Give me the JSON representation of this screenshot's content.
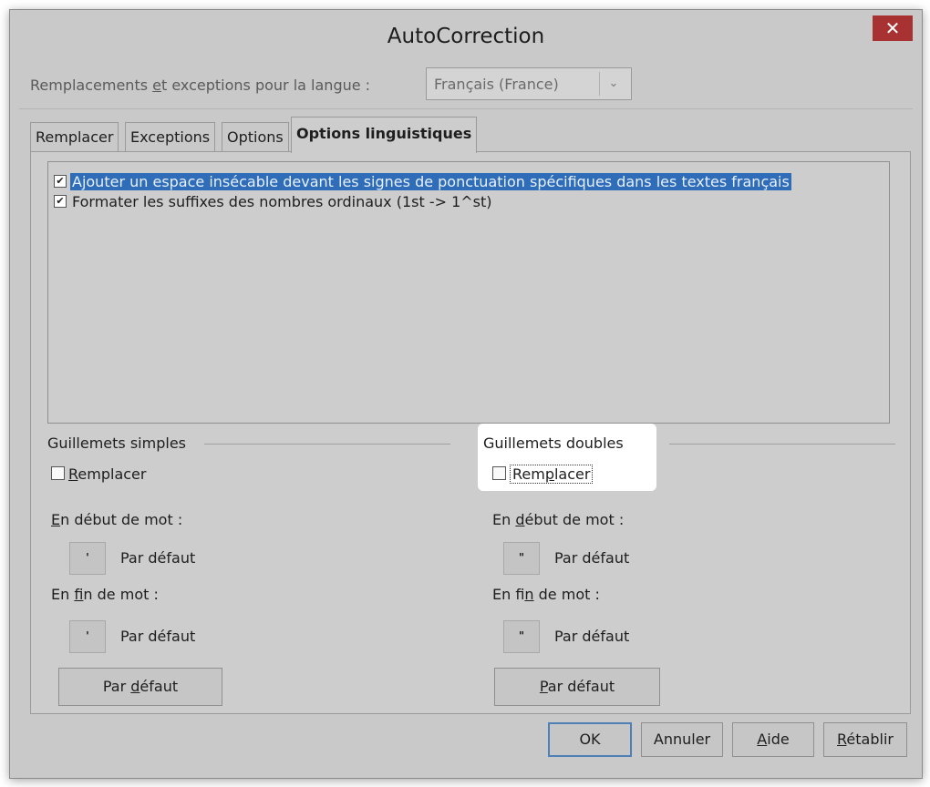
{
  "window": {
    "title": "AutoCorrection",
    "close_glyph": "✕"
  },
  "language": {
    "label_before": "Remplacements ",
    "label_accel": "e",
    "label_after": "t exceptions pour la langue :",
    "selected": "Français (France)",
    "arrow_icon": "chevron-down-icon"
  },
  "tabs": [
    {
      "label": "Remplacer",
      "active": false
    },
    {
      "label": "Exceptions",
      "active": false
    },
    {
      "label": "Options",
      "active": false
    },
    {
      "label": "Options linguistiques",
      "active": true
    }
  ],
  "options": [
    {
      "label": "Ajouter un espace insécable devant les signes de ponctuation spécifiques dans les textes français",
      "checked": true,
      "selected": true
    },
    {
      "label": "Formater les suffixes des nombres ordinaux (1st -> 1^st)",
      "checked": true,
      "selected": false
    }
  ],
  "single_quotes": {
    "group_label": "Guillemets simples",
    "replace_accel": "R",
    "replace_rest": "emplacer",
    "start_accel": "E",
    "start_rest": "n début de mot :",
    "start_symbol": "'",
    "start_value": "Par défaut",
    "end_before": "En ",
    "end_accel": "f",
    "end_after": "in de mot :",
    "end_symbol": "'",
    "end_value": "Par défaut",
    "default_before": "Par ",
    "default_accel": "d",
    "default_after": "éfaut"
  },
  "double_quotes": {
    "group_label": "Guillemets doubles",
    "replace_before": "Rem",
    "replace_accel": "p",
    "replace_after": "lacer",
    "start_before": "En ",
    "start_accel": "d",
    "start_after": "ébut de mot :",
    "start_symbol": "\"",
    "start_value": "Par défaut",
    "end_before": "En fi",
    "end_accel": "n",
    "end_after": " de mot :",
    "end_symbol": "\"",
    "end_value": "Par défaut",
    "default_accel": "P",
    "default_after": "ar défaut"
  },
  "footer": {
    "ok": "OK",
    "cancel": "Annuler",
    "help_accel": "A",
    "help_rest": "ide",
    "reset_accel": "R",
    "reset_rest": "établir"
  }
}
